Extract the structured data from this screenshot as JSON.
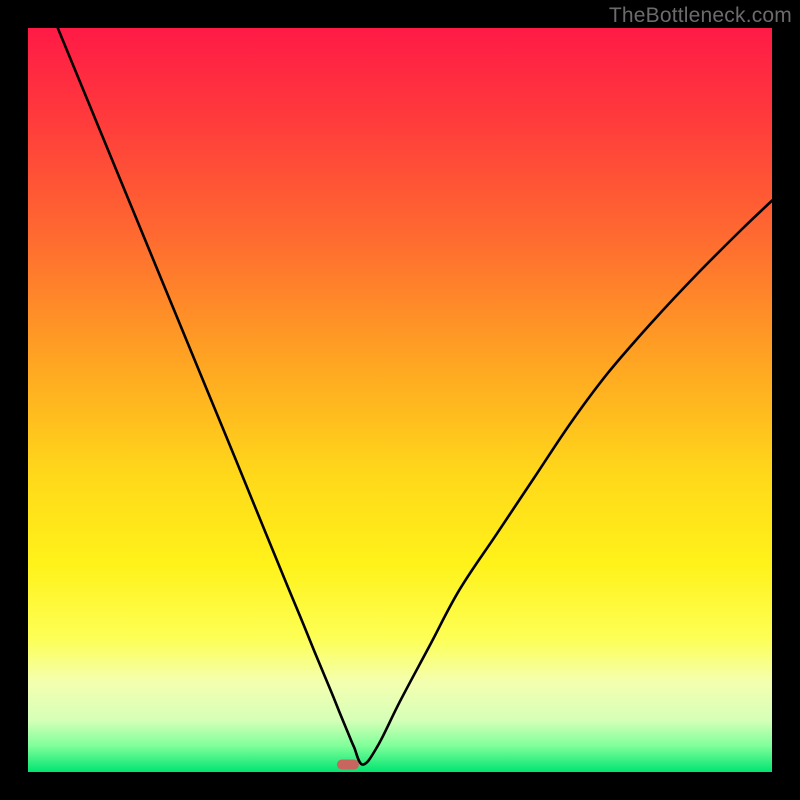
{
  "watermark": "TheBottleneck.com",
  "colors": {
    "gradient_stops": [
      {
        "offset": 0.0,
        "color": "#ff1a46"
      },
      {
        "offset": 0.12,
        "color": "#ff3a3c"
      },
      {
        "offset": 0.28,
        "color": "#ff6a30"
      },
      {
        "offset": 0.45,
        "color": "#ffa522"
      },
      {
        "offset": 0.6,
        "color": "#ffd81a"
      },
      {
        "offset": 0.72,
        "color": "#fff21a"
      },
      {
        "offset": 0.82,
        "color": "#fdff55"
      },
      {
        "offset": 0.88,
        "color": "#f4ffb0"
      },
      {
        "offset": 0.93,
        "color": "#d6ffb8"
      },
      {
        "offset": 0.965,
        "color": "#7fff9a"
      },
      {
        "offset": 1.0,
        "color": "#00e571"
      }
    ],
    "curve_stroke": "#000000",
    "marker_fill": "#c9655f",
    "background": "#000000"
  },
  "chart_data": {
    "type": "line",
    "title": "",
    "xlabel": "",
    "ylabel": "",
    "xlim": [
      0,
      100
    ],
    "ylim": [
      0,
      100
    ],
    "grid": false,
    "legend": false,
    "series": [
      {
        "name": "curve",
        "x": [
          4,
          8,
          12,
          16,
          20,
          24,
          28,
          32,
          35,
          37,
          38.5,
          40,
          41,
          41.8,
          42.5,
          43,
          43.8,
          45,
          47,
          50,
          54,
          58,
          63,
          68,
          73,
          78,
          84,
          90,
          96,
          100
        ],
        "y": [
          100,
          90.3,
          80.6,
          70.9,
          61.2,
          51.5,
          41.8,
          32.0,
          24.7,
          19.9,
          16.2,
          12.6,
          10.2,
          8.2,
          6.5,
          5.3,
          3.4,
          1.0,
          3.5,
          9.5,
          17.0,
          24.5,
          32.0,
          39.5,
          47.0,
          53.7,
          60.6,
          67.0,
          73.0,
          76.8
        ]
      }
    ],
    "marker": {
      "x": 43,
      "y": 1.0
    },
    "description": "V-shaped bottleneck curve on red→yellow→green vertical gradient. Steep near-linear descent from upper-left to a minimum near x≈43, then a concave rise toward upper-right. Single pill-shaped marker at the minimum near the bottom edge."
  }
}
